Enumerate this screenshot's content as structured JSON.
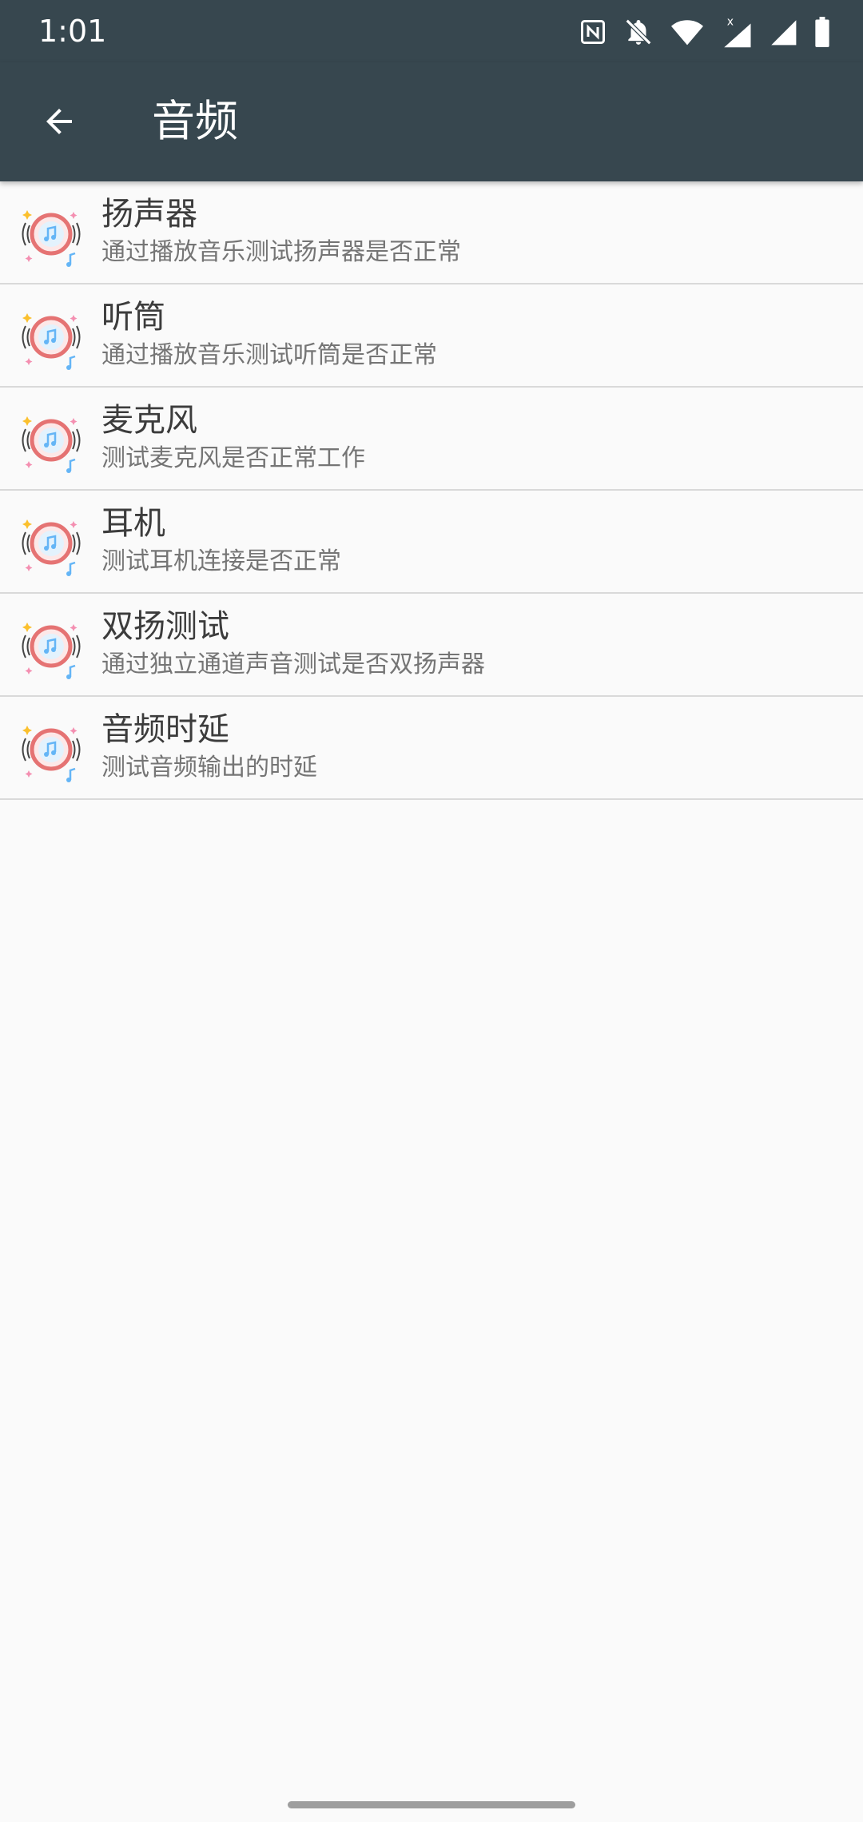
{
  "status_bar": {
    "time": "1:01",
    "icons": [
      "nfc-icon",
      "bell-off-icon",
      "wifi-icon",
      "signal-icon",
      "signal-icon",
      "battery-icon"
    ],
    "network_mark": "x"
  },
  "app_bar": {
    "title": "音频",
    "back_icon": "arrow-back-icon"
  },
  "list": {
    "items": [
      {
        "title": "扬声器",
        "subtitle": "通过播放音乐测试扬声器是否正常",
        "icon": "music-speaker-icon"
      },
      {
        "title": "听筒",
        "subtitle": "通过播放音乐测试听筒是否正常",
        "icon": "music-speaker-icon"
      },
      {
        "title": "麦克风",
        "subtitle": "测试麦克风是否正常工作",
        "icon": "music-speaker-icon"
      },
      {
        "title": "耳机",
        "subtitle": "测试耳机连接是否正常",
        "icon": "music-speaker-icon"
      },
      {
        "title": "双扬测试",
        "subtitle": "通过独立通道声音测试是否双扬声器",
        "icon": "music-speaker-icon"
      },
      {
        "title": "音频时延",
        "subtitle": "测试音频输出的时延",
        "icon": "music-speaker-icon"
      }
    ]
  },
  "colors": {
    "app_bar": "#37474f",
    "background": "#fafafa",
    "icon_ring": "#e57373",
    "icon_note": "#64b5f6"
  }
}
